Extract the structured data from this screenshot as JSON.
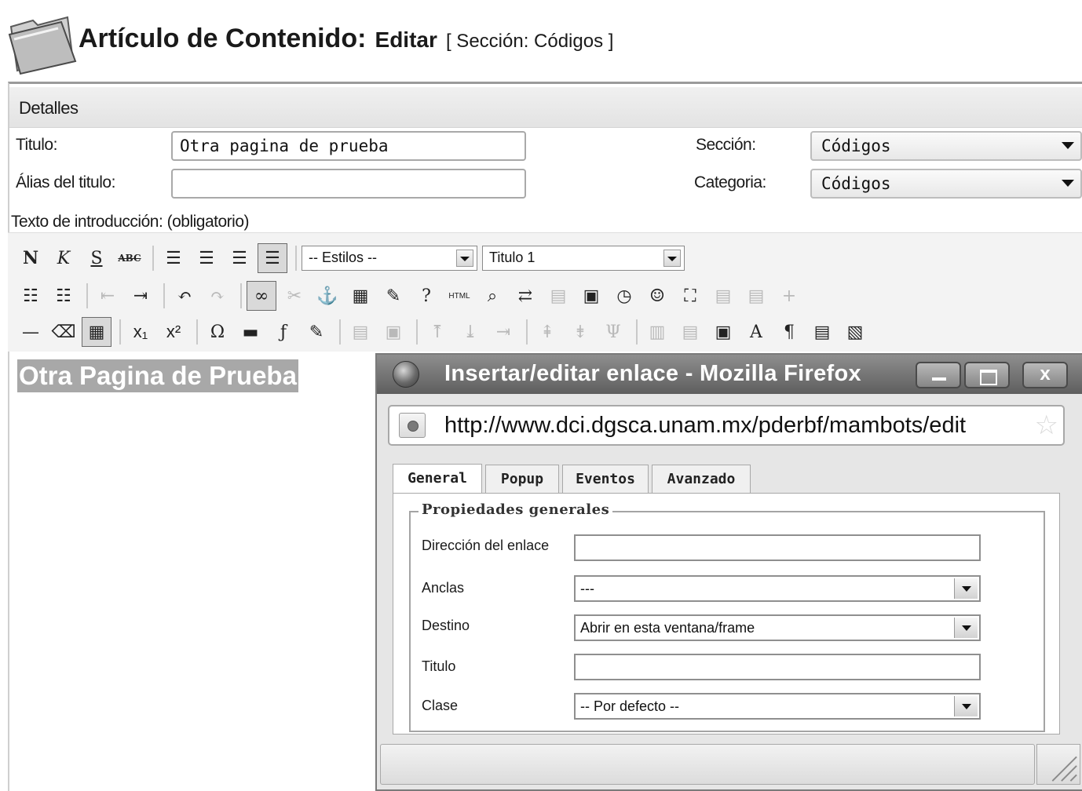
{
  "page": {
    "title": "Artículo de Contenido:",
    "action": "Editar",
    "section_label": "[ Sección: Códigos ]"
  },
  "details": {
    "header": "Detalles",
    "title_label": "Titulo:",
    "title_value": "Otra pagina de prueba",
    "alias_label": "Álias del titulo:",
    "alias_value": "",
    "section_label": "Sección:",
    "section_value": "Códigos",
    "category_label": "Categoria:",
    "category_value": "Códigos",
    "intro_label": "Texto de introducción: (obligatorio)"
  },
  "toolbar": {
    "styles_value": "-- Estilos --",
    "format_value": "Titulo 1"
  },
  "editor": {
    "heading": "Otra Pagina de Prueba"
  },
  "popup": {
    "window_title": "Insertar/editar enlace - Mozilla Firefox",
    "close_symbol": "x",
    "url": "http://www.dci.dgsca.unam.mx/pderbf/mambots/edit",
    "tabs": [
      "General",
      "Popup",
      "Eventos",
      "Avanzado"
    ],
    "active_tab": "General",
    "legend": "Propiedades generales",
    "fields": {
      "link_url_label": "Dirección del enlace",
      "link_url_value": "",
      "anchors_label": "Anclas",
      "anchors_value": "---",
      "target_label": "Destino",
      "target_value": "Abrir en esta ventana/frame",
      "title_label": "Titulo",
      "title_value": "",
      "class_label": "Clase",
      "class_value": "-- Por defecto --"
    }
  },
  "icons": [
    "folder-icon",
    "bold-icon",
    "italic-icon",
    "underline-icon",
    "strikethrough-icon",
    "align-left-icon",
    "align-center-icon",
    "align-right-icon",
    "align-justify-icon",
    "bullet-list-icon",
    "numbered-list-icon",
    "outdent-icon",
    "indent-icon",
    "undo-icon",
    "redo-icon",
    "link-icon",
    "unlink-icon",
    "anchor-icon",
    "image-icon",
    "cleanup-icon",
    "help-icon",
    "html-icon",
    "search-icon",
    "replace-icon",
    "paste-icon",
    "date-icon",
    "time-icon",
    "emotions-icon",
    "fullscreen-icon",
    "hr-icon",
    "eraser-icon",
    "table-icon",
    "subscript-icon",
    "superscript-icon",
    "omega-icon",
    "flash-icon",
    "media-icon",
    "pilcrow-icon",
    "firefox-icon",
    "star-icon",
    "resize-grip-icon"
  ],
  "colors": {
    "titlebar": "#6e6e6e",
    "selection": "#a8a8a8",
    "panel": "#e6e6e6"
  }
}
